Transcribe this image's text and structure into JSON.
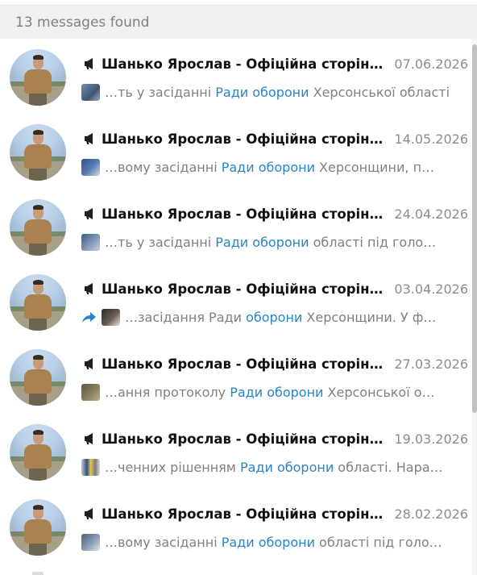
{
  "header": {
    "count_text": "13 messages found"
  },
  "results": [
    {
      "title": "Шанько Ярослав - Офіційна сторінка",
      "date": "07.06.2026",
      "forwarded": false,
      "snippet_pre": "…ть у засіданні ",
      "snippet_hl": "Ради оборони",
      "snippet_mid": "",
      "snippet_hl2": "",
      "snippet_post": " Херсонської області"
    },
    {
      "title": "Шанько Ярослав - Офіційна сторінка",
      "date": "14.05.2026",
      "forwarded": false,
      "snippet_pre": "…вому засіданні ",
      "snippet_hl": "Ради оборони",
      "snippet_mid": "",
      "snippet_hl2": "",
      "snippet_post": " Херсонщини, п…"
    },
    {
      "title": "Шанько Ярослав - Офіційна сторінка",
      "date": "24.04.2026",
      "forwarded": false,
      "snippet_pre": "…ть у засіданні ",
      "snippet_hl": "Ради оборони",
      "snippet_mid": "",
      "snippet_hl2": "",
      "snippet_post": " області під голо…"
    },
    {
      "title": "Шанько Ярослав - Офіційна сторінка",
      "date": "03.04.2026",
      "forwarded": true,
      "snippet_pre": "…засідання Ради ",
      "snippet_hl": "оборони",
      "snippet_mid": "",
      "snippet_hl2": "",
      "snippet_post": " Херсонщини. У ф…"
    },
    {
      "title": "Шанько Ярослав - Офіційна сторінка",
      "date": "27.03.2026",
      "forwarded": false,
      "snippet_pre": "…ання протоколу ",
      "snippet_hl": "Ради оборони",
      "snippet_mid": "",
      "snippet_hl2": "",
      "snippet_post": " Херсонської о…"
    },
    {
      "title": "Шанько Ярослав - Офіційна сторінка",
      "date": "19.03.2026",
      "forwarded": false,
      "snippet_pre": "…ченних рішенням ",
      "snippet_hl": "Ради оборони",
      "snippet_mid": "",
      "snippet_hl2": "",
      "snippet_post": " області. Нара…"
    },
    {
      "title": "Шанько Ярослав - Офіційна сторінка",
      "date": "28.02.2026",
      "forwarded": false,
      "snippet_pre": "…вому засіданні ",
      "snippet_hl": "Ради оборони",
      "snippet_mid": "",
      "snippet_hl2": "",
      "snippet_post": " області під голо…"
    }
  ],
  "icons": {
    "channel": "megaphone-icon",
    "forward": "forward-arrow-icon"
  },
  "colors": {
    "highlight": "#2a84c6",
    "header_bg": "#f1f1f1",
    "muted_text": "#808080"
  }
}
